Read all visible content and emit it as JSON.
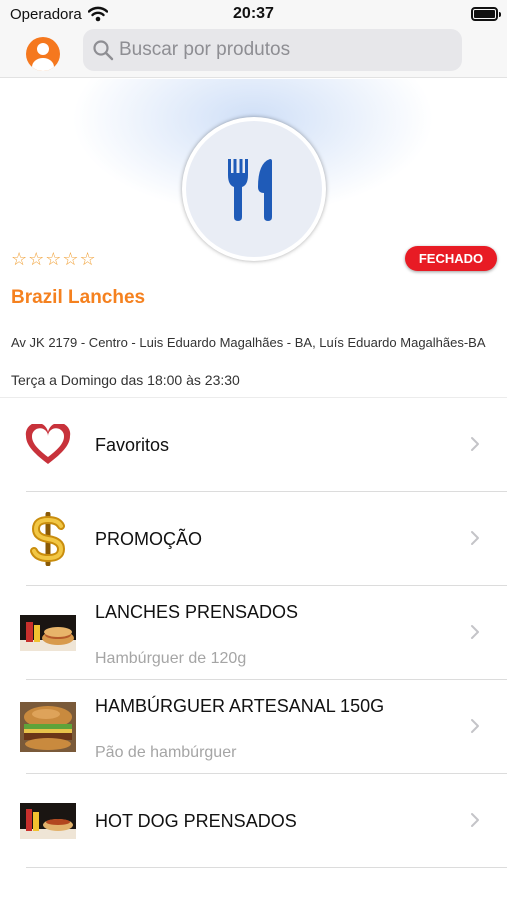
{
  "status_bar": {
    "carrier": "Operadora",
    "time": "20:37"
  },
  "search": {
    "placeholder": "Buscar por produtos"
  },
  "store": {
    "rating_stars": "☆☆☆☆☆",
    "status_badge": "FECHADO",
    "name": "Brazil Lanches",
    "address": "Av JK 2179 - Centro - Luis Eduardo Magalhães - BA, Luís Eduardo Magalhães-BA",
    "hours": "Terça a Domingo das 18:00 às 23:30"
  },
  "colors": {
    "accent": "#f5811f",
    "badge": "#e81b24",
    "logo_icon": "#1f5bb8",
    "heart": "#c8323b"
  },
  "menu": [
    {
      "title": "Favoritos",
      "icon": "heart-icon"
    },
    {
      "title": "PROMOÇÃO",
      "icon": "dollar-icon"
    },
    {
      "title": "LANCHES PRENSADOS",
      "subtitle": "Hambúrguer de 120g",
      "icon": "sandwich-photo"
    },
    {
      "title": "HAMBÚRGUER ARTESANAL 150G",
      "subtitle": "Pão de hambúrguer",
      "icon": "burger-photo"
    },
    {
      "title": "HOT DOG PRENSADOS",
      "icon": "hotdog-photo"
    }
  ]
}
